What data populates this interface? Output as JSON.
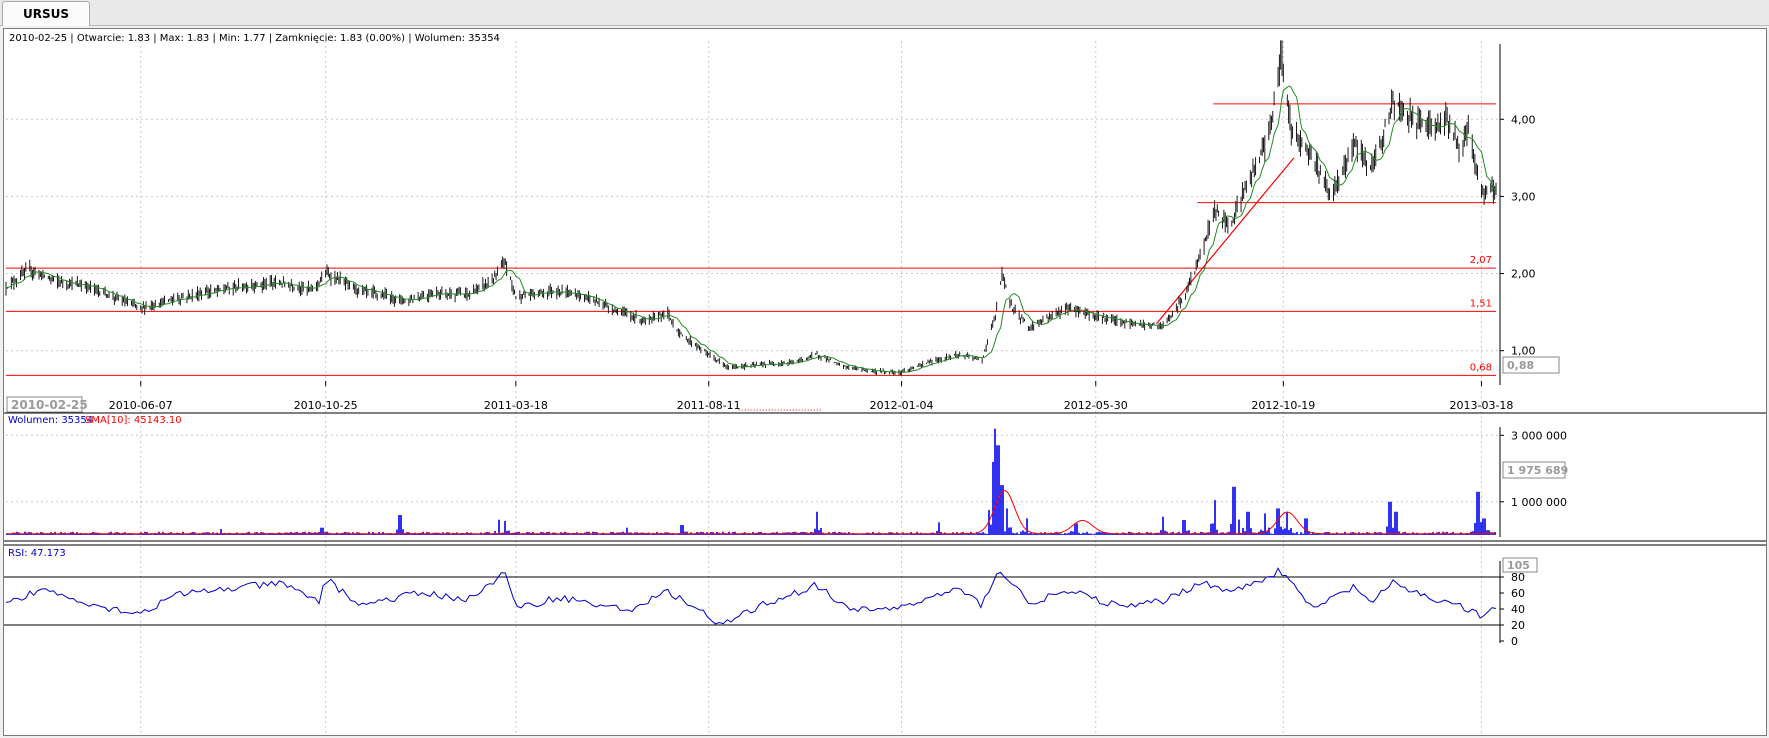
{
  "tab": {
    "label": "URSUS"
  },
  "price_panel": {
    "info_line": "2010-02-25 | Otwarcie: 1.83 | Max: 1.83 | Min: 1.77 | Zamknięcie: 1.83 (0.00%) | Wolumen: 35354",
    "cursor_date": "2010-02-25",
    "cursor_value": "0,88",
    "line_labels": [
      "2,07",
      "1,51",
      "0,68"
    ]
  },
  "volume_panel": {
    "legend_volume": "Wolumen: 35354",
    "legend_sma": "SMA[10]: 45143.10",
    "cursor_value": "1 975 689"
  },
  "rsi_panel": {
    "legend": "RSI: 47.173",
    "cursor_value": "105"
  },
  "colors": {
    "candle": "#000000",
    "sma": "#228b22",
    "hline": "#ff0000",
    "volume": "#0000ee",
    "volume_sma": "#ff0000",
    "rsi": "#0000cc",
    "grid": "#c8c8c8"
  },
  "chart_data": [
    {
      "type": "candlestick",
      "x_labels": [
        "2010-06-07",
        "2010-10-25",
        "2011-03-18",
        "2011-08-11",
        "2012-01-04",
        "2012-05-30",
        "2012-10-19",
        "2013-03-18"
      ],
      "y_ticks": [
        "1,00",
        "2,00",
        "3,00",
        "4,00"
      ],
      "ylim": [
        0.62,
        4.95
      ],
      "horizontal_lines": [
        {
          "value": 4.2,
          "from": "2012-08-27",
          "to": "2013-03-29"
        },
        {
          "value": 2.92,
          "from": "2012-08-15",
          "to": "2013-03-29"
        },
        {
          "value": 2.07,
          "label": "2,07",
          "from": "2010-02-25",
          "to": "2013-03-29"
        },
        {
          "value": 1.51,
          "label": "1,51",
          "from": "2010-02-25",
          "to": "2013-03-29"
        },
        {
          "value": 0.68,
          "label": "0,68",
          "from": "2010-02-25",
          "to": "2013-03-29"
        }
      ],
      "trend_line": {
        "from": [
          "2012-07-15",
          1.35
        ],
        "to": [
          "2012-10-27",
          3.5
        ]
      },
      "close": [
        [
          "2010-02-25",
          1.83
        ],
        [
          "2010-03-15",
          2.05
        ],
        [
          "2010-04-05",
          1.9
        ],
        [
          "2010-05-01",
          1.82
        ],
        [
          "2010-06-07",
          1.55
        ],
        [
          "2010-07-05",
          1.68
        ],
        [
          "2010-08-09",
          1.8
        ],
        [
          "2010-09-01",
          1.85
        ],
        [
          "2010-09-20",
          1.88
        ],
        [
          "2010-10-15",
          1.79
        ],
        [
          "2010-10-25",
          2.0
        ],
        [
          "2010-11-20",
          1.78
        ],
        [
          "2010-12-25",
          1.65
        ],
        [
          "2011-01-15",
          1.75
        ],
        [
          "2011-02-10",
          1.73
        ],
        [
          "2011-03-01",
          1.92
        ],
        [
          "2011-03-10",
          2.15
        ],
        [
          "2011-03-18",
          1.7
        ],
        [
          "2011-04-15",
          1.78
        ],
        [
          "2011-05-10",
          1.7
        ],
        [
          "2011-06-05",
          1.5
        ],
        [
          "2011-06-25",
          1.38
        ],
        [
          "2011-07-10",
          1.5
        ],
        [
          "2011-07-20",
          1.22
        ],
        [
          "2011-08-11",
          0.95
        ],
        [
          "2011-08-25",
          0.78
        ],
        [
          "2011-09-20",
          0.82
        ],
        [
          "2011-10-15",
          0.85
        ],
        [
          "2011-11-01",
          0.95
        ],
        [
          "2011-11-20",
          0.8
        ],
        [
          "2011-12-15",
          0.73
        ],
        [
          "2012-01-04",
          0.72
        ],
        [
          "2012-01-25",
          0.85
        ],
        [
          "2012-02-15",
          0.95
        ],
        [
          "2012-03-05",
          0.88
        ],
        [
          "2012-03-15",
          1.45
        ],
        [
          "2012-03-20",
          1.98
        ],
        [
          "2012-03-28",
          1.55
        ],
        [
          "2012-04-10",
          1.3
        ],
        [
          "2012-05-01",
          1.5
        ],
        [
          "2012-05-10",
          1.55
        ],
        [
          "2012-05-30",
          1.45
        ],
        [
          "2012-06-20",
          1.36
        ],
        [
          "2012-07-20",
          1.31
        ],
        [
          "2012-08-05",
          1.7
        ],
        [
          "2012-08-20",
          2.35
        ],
        [
          "2012-08-28",
          2.85
        ],
        [
          "2012-09-08",
          2.62
        ],
        [
          "2012-09-20",
          3.1
        ],
        [
          "2012-10-05",
          3.65
        ],
        [
          "2012-10-12",
          4.2
        ],
        [
          "2012-10-17",
          4.85
        ],
        [
          "2012-10-25",
          3.9
        ],
        [
          "2012-11-10",
          3.5
        ],
        [
          "2012-11-25",
          3.0
        ],
        [
          "2012-12-12",
          3.7
        ],
        [
          "2012-12-25",
          3.35
        ],
        [
          "2013-01-10",
          4.2
        ],
        [
          "2013-01-25",
          4.0
        ],
        [
          "2013-02-10",
          3.85
        ],
        [
          "2013-02-20",
          4.05
        ],
        [
          "2013-03-01",
          3.6
        ],
        [
          "2013-03-08",
          3.9
        ],
        [
          "2013-03-18",
          3.05
        ],
        [
          "2013-03-29",
          3.08
        ]
      ]
    },
    {
      "type": "bar",
      "series": [
        {
          "name": "Wolumen"
        },
        {
          "name": "SMA[10]"
        }
      ],
      "y_ticks": [
        "1 000 000",
        "3 000 000"
      ],
      "ylim": [
        0,
        3250000
      ],
      "volume_spikes": [
        [
          "2010-08-07",
          180000
        ],
        [
          "2010-10-22",
          220000
        ],
        [
          "2010-12-20",
          600000
        ],
        [
          "2011-03-05",
          460000
        ],
        [
          "2011-03-10",
          420000
        ],
        [
          "2011-06-10",
          220000
        ],
        [
          "2011-07-22",
          300000
        ],
        [
          "2011-11-01",
          700000
        ],
        [
          "2012-02-01",
          380000
        ],
        [
          "2012-03-13",
          2200000
        ],
        [
          "2012-03-15",
          3200000
        ],
        [
          "2012-03-17",
          2700000
        ],
        [
          "2012-03-20",
          1500000
        ],
        [
          "2012-03-24",
          800000
        ],
        [
          "2012-04-08",
          500000
        ],
        [
          "2012-05-15",
          350000
        ],
        [
          "2012-07-20",
          550000
        ],
        [
          "2012-08-05",
          450000
        ],
        [
          "2012-08-28",
          1050000
        ],
        [
          "2012-09-12",
          1450000
        ],
        [
          "2012-09-22",
          700000
        ],
        [
          "2012-10-05",
          650000
        ],
        [
          "2012-10-15",
          800000
        ],
        [
          "2012-10-22",
          700000
        ],
        [
          "2012-11-05",
          500000
        ],
        [
          "2013-01-08",
          1000000
        ],
        [
          "2013-01-12",
          700000
        ],
        [
          "2013-03-15",
          1300000
        ],
        [
          "2013-03-20",
          500000
        ]
      ],
      "sma_peaks": [
        [
          "2012-03-22",
          1300000
        ],
        [
          "2012-05-20",
          400000
        ],
        [
          "2012-10-22",
          650000
        ]
      ]
    },
    {
      "type": "line",
      "series": [
        {
          "name": "RSI"
        }
      ],
      "y_ticks": [
        "0",
        "20",
        "40",
        "60",
        "80"
      ],
      "ylim": [
        0,
        100
      ],
      "reference_lines": [
        20,
        80
      ],
      "points": [
        [
          "2010-02-25",
          47
        ],
        [
          "2010-03-08",
          52
        ],
        [
          "2010-03-22",
          65
        ],
        [
          "2010-04-15",
          55
        ],
        [
          "2010-05-10",
          42
        ],
        [
          "2010-06-07",
          35
        ],
        [
          "2010-07-05",
          58
        ],
        [
          "2010-08-09",
          65
        ],
        [
          "2010-09-20",
          72
        ],
        [
          "2010-10-20",
          50
        ],
        [
          "2010-10-25",
          78
        ],
        [
          "2010-11-20",
          45
        ],
        [
          "2011-01-05",
          60
        ],
        [
          "2011-02-10",
          52
        ],
        [
          "2011-03-10",
          85
        ],
        [
          "2011-03-18",
          40
        ],
        [
          "2011-04-20",
          55
        ],
        [
          "2011-06-10",
          38
        ],
        [
          "2011-07-12",
          62
        ],
        [
          "2011-08-11",
          30
        ],
        [
          "2011-08-18",
          18
        ],
        [
          "2011-09-20",
          45
        ],
        [
          "2011-11-01",
          70
        ],
        [
          "2011-11-25",
          38
        ],
        [
          "2012-01-04",
          42
        ],
        [
          "2012-02-15",
          65
        ],
        [
          "2012-03-05",
          45
        ],
        [
          "2012-03-17",
          90
        ],
        [
          "2012-04-10",
          48
        ],
        [
          "2012-05-10",
          62
        ],
        [
          "2012-06-20",
          42
        ],
        [
          "2012-07-20",
          50
        ],
        [
          "2012-08-20",
          75
        ],
        [
          "2012-09-08",
          60
        ],
        [
          "2012-10-17",
          88
        ],
        [
          "2012-11-10",
          40
        ],
        [
          "2012-12-12",
          68
        ],
        [
          "2012-12-25",
          48
        ],
        [
          "2013-01-10",
          72
        ],
        [
          "2013-02-10",
          52
        ],
        [
          "2013-03-01",
          45
        ],
        [
          "2013-03-18",
          30
        ],
        [
          "2013-03-29",
          42
        ]
      ]
    }
  ]
}
